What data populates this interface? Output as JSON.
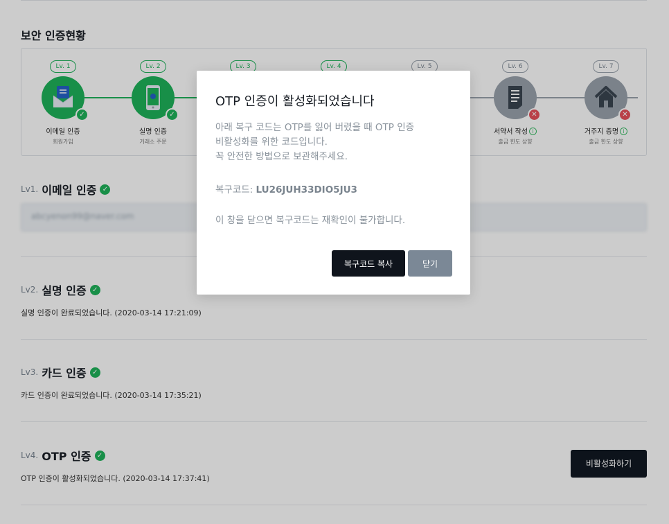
{
  "section_title": "보안 인증현황",
  "steps": [
    {
      "badge": "Lv. 1",
      "name": "이메일 인증",
      "sub": "회원가입",
      "status": "done",
      "icon": "envelope-icon"
    },
    {
      "badge": "Lv. 2",
      "name": "실명 인증",
      "sub": "거래소 주문",
      "status": "done",
      "icon": "phone-icon"
    },
    {
      "badge": "Lv. 3",
      "name": "",
      "sub": "",
      "status": "done",
      "icon": "card-icon"
    },
    {
      "badge": "Lv. 4",
      "name": "",
      "sub": "",
      "status": "done",
      "icon": "otp-icon"
    },
    {
      "badge": "Lv. 5",
      "name": "",
      "sub": "",
      "status": "pending",
      "icon": "bank-icon"
    },
    {
      "badge": "Lv. 6",
      "name": "서약서 작성",
      "sub": "출금 한도 상향",
      "status": "failed",
      "icon": "document-icon"
    },
    {
      "badge": "Lv. 7",
      "name": "거주지 증명",
      "sub": "출금 한도 상향",
      "status": "failed",
      "icon": "house-icon"
    }
  ],
  "levels": {
    "lv1": {
      "tag": "Lv1.",
      "title": "이메일 인증",
      "email": "abcyenon99@naver.com"
    },
    "lv2": {
      "tag": "Lv2.",
      "title": "실명 인증",
      "desc": "실명 인증이 완료되었습니다. (2020-03-14 17:21:09)"
    },
    "lv3": {
      "tag": "Lv3.",
      "title": "카드 인증",
      "desc": "카드 인증이 완료되었습니다. (2020-03-14 17:35:21)"
    },
    "lv4": {
      "tag": "Lv4.",
      "title": "OTP 인증",
      "desc": "OTP 인증이 활성화되었습니다. (2020-03-14 17:37:41)",
      "button": "비활성화하기"
    }
  },
  "modal": {
    "title": "OTP 인증이 활성화되었습니다",
    "body_line1": "아래 복구 코드는 OTP를 잃어 버렸을 때 OTP 인증",
    "body_line2": "비활성화를 위한 코드입니다.",
    "body_line3": "꼭 안전한 방법으로 보관해주세요.",
    "code_label": "복구코드:",
    "code_value": "LU26JUH33DIO5JU3",
    "warning": "이 창을 닫으면 복구코드는 재확인이 불가합니다.",
    "copy_button": "복구코드 복사",
    "close_button": "닫기"
  },
  "colors": {
    "success": "#1fb35b",
    "fail": "#e8505b",
    "inactive": "#9aa3ad",
    "dark_button": "#111822",
    "gray_button": "#7b8896"
  }
}
